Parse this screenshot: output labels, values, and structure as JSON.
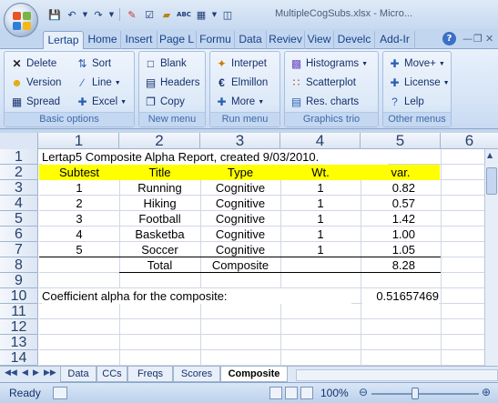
{
  "window": {
    "title": "MultipleCogSubs.xlsx - Micro...",
    "quick_access": [
      "save-icon",
      "undo-icon",
      "redo-icon",
      "pencil-icon",
      "checkbox-icon",
      "eraser-icon",
      "spelling-icon",
      "sort-icon",
      "customize-icon"
    ]
  },
  "tabs": [
    "Lertap",
    "Home",
    "Insert",
    "Page L",
    "Formu",
    "Data",
    "Reviev",
    "View",
    "Develc",
    "Add-Ir"
  ],
  "active_tab": "Lertap",
  "ribbon": {
    "groups": [
      {
        "label": "Basic options",
        "buttons": [
          "Delete",
          "Version",
          "Spread",
          "Sort",
          "Line",
          "Excel"
        ]
      },
      {
        "label": "New menu",
        "buttons": [
          "Blank",
          "Headers",
          "Copy"
        ]
      },
      {
        "label": "Run menu",
        "buttons": [
          "Interpet",
          "Elmillon",
          "More"
        ]
      },
      {
        "label": "Graphics trio",
        "buttons": [
          "Histograms",
          "Scatterplot",
          "Res. charts"
        ]
      },
      {
        "label": "Other menus",
        "buttons": [
          "Move+",
          "License",
          "Lelp"
        ]
      }
    ]
  },
  "sheet": {
    "column_headers": [
      "1",
      "2",
      "3",
      "4",
      "5",
      "6"
    ],
    "row_headers": [
      "1",
      "2",
      "3",
      "4",
      "5",
      "6",
      "7",
      "8",
      "9",
      "10",
      "11",
      "12",
      "13",
      "14"
    ],
    "report_title": "Lertap5 Composite Alpha Report, created 9/03/2010.",
    "table_headers": [
      "Subtest",
      "Title",
      "Type",
      "Wt.",
      "var."
    ],
    "rows": [
      [
        "1",
        "Running",
        "Cognitive",
        "1",
        "0.82"
      ],
      [
        "2",
        "Hiking",
        "Cognitive",
        "1",
        "0.57"
      ],
      [
        "3",
        "Football",
        "Cognitive",
        "1",
        "1.42"
      ],
      [
        "4",
        "Basketba",
        "Cognitive",
        "1",
        "1.00"
      ],
      [
        "5",
        "Soccer",
        "Cognitive",
        "1",
        "1.05"
      ]
    ],
    "total_row": {
      "title": "Total",
      "type": "Composite",
      "var": "8.28"
    },
    "alpha_label": "Coefficient alpha for the composite:",
    "alpha_value": "0.51657469",
    "header_fill": "#ffff00"
  },
  "sheet_tabs": [
    "Data",
    "CCs",
    "Freqs",
    "Scores",
    "Composite"
  ],
  "active_sheet": "Composite",
  "status": {
    "text": "Ready",
    "zoom": "100%"
  }
}
